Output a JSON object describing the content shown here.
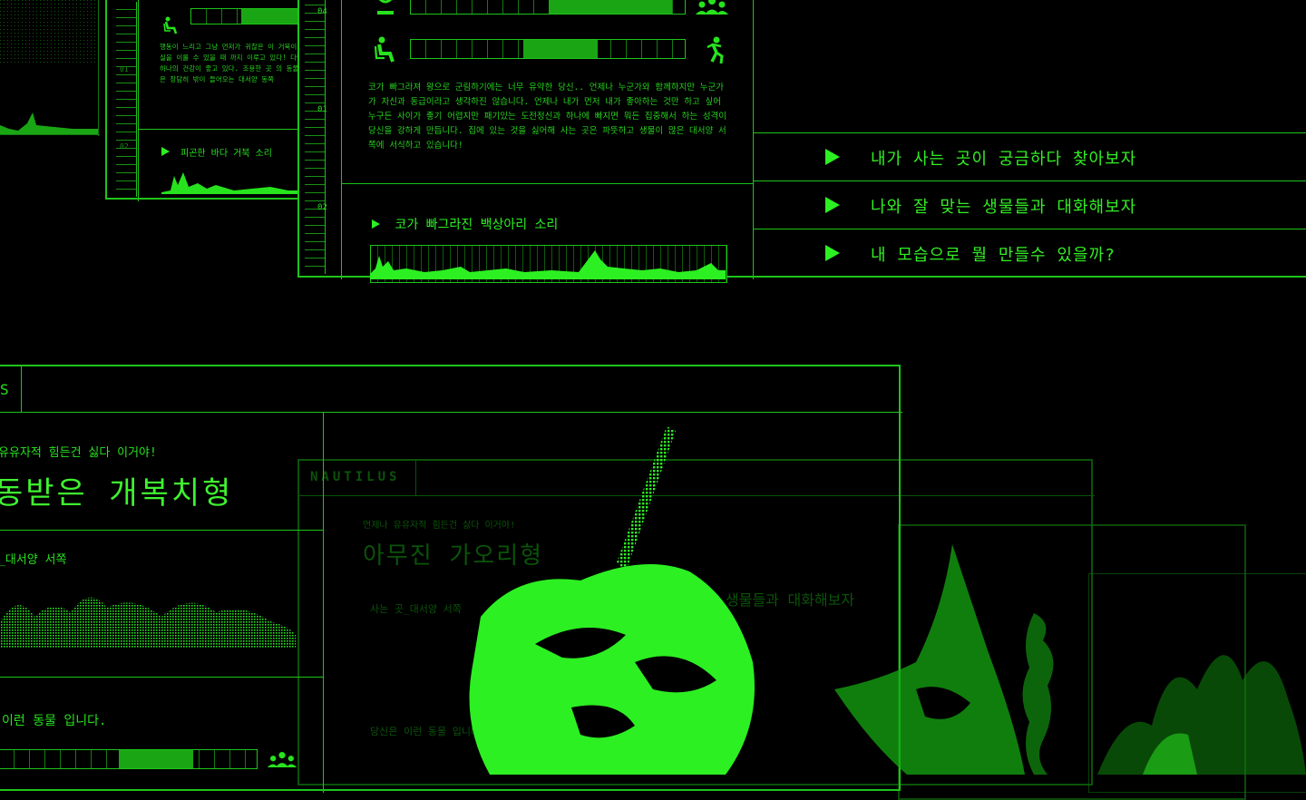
{
  "top_panel": {
    "ruler_labels": [
      "04",
      "01",
      "02"
    ],
    "description": "코가 빠그라져 왕으로 군림하기에는 너무 유약한 당신.. 언제나 누군가와 함께하지만 누군가가 자신과 동급이라고 생각하진 않습니다. 언제나 내가 먼저 내가 좋아하는 것만 하고 싶어 누구든 사이가 좋기 어렵지만 패기있는 도전정신과 하나에 빠지면 뭐든 집중해서 하는 성격이 당신을 강하게 만듭니다. 집에 있는 것을 싫어해 사는 곳은 파뜻하고 생물이 많은 대서양 서쪽에 서식하고 있습니다!",
    "sound_label": "코가 빠그라진 백상아리 소리",
    "bar1_fill": 0.55,
    "bar2_fill": 0.27
  },
  "left_top_panel": {
    "ruler_labels": [
      "01",
      "02"
    ],
    "description": "행동이 느리고 그냥 먼저가 귀찮은 이 거북이 실을 이룰 수 있을 때 까지 이루고 있다! 다만 하나의 건강이 좋고 있다. 조용한 곳 의 동물은 장담히 밖이 들어오는 대서양 동쪽",
    "sound_label": "피곤한 바다 거북 소리"
  },
  "menu": {
    "items": [
      {
        "label": "내가 사는 곳이 궁금하다 찾아보자"
      },
      {
        "label": "나와 잘 맞는 생물들과 대화해보자"
      },
      {
        "label": "내 모습으로 뭘 만들수 있을까?"
      }
    ]
  },
  "bottom_panel": {
    "tab_label": "S",
    "subtitle": "유유자적 힘든건 싫다 이거야!",
    "title": "동받은 개복치형",
    "habitat_label": "_대서양 서쪽",
    "caption": "이런 동물 입니다.",
    "bar_fill": 0.3
  },
  "back_panel": {
    "brand": "NAUTILUS",
    "subtitle": "언제나 유유자적 힘든건 싫다 이거야!",
    "title": "아무진 가오리형",
    "habitat_label": "사는 곳_대서양 서쪽",
    "caption": "당신은 이런 동물 입니다.",
    "right_text": "생물들과 대화해보자"
  },
  "colors": {
    "accent": "#27e31d",
    "dim": "#1b8f16",
    "background": "#000000"
  },
  "icons": [
    "person-sitting-icon",
    "group-icon",
    "person-jumping-icon",
    "play-icon",
    "person-icon"
  ]
}
